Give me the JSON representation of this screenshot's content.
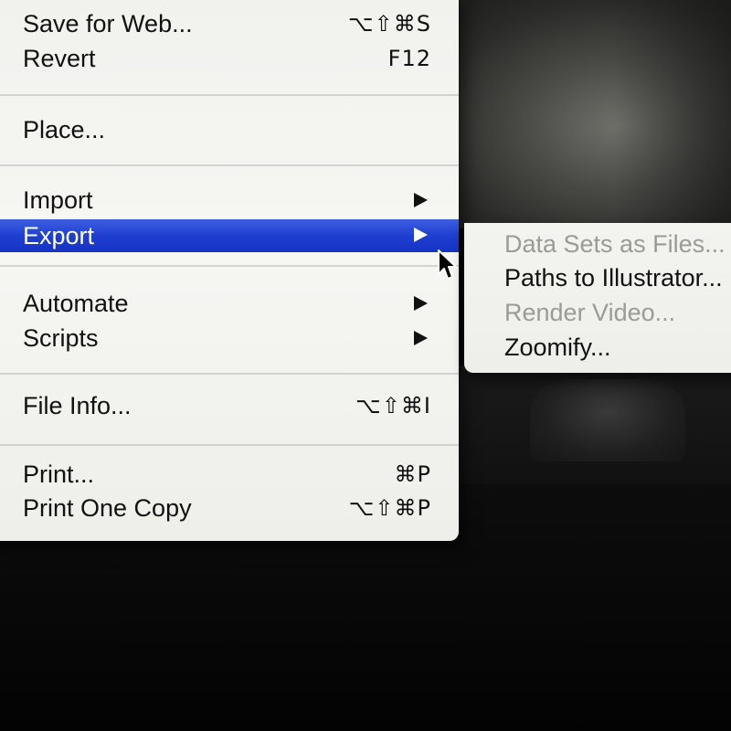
{
  "file_menu": {
    "items": [
      {
        "label": "Save for Web...",
        "shortcut": "⌥⇧⌘S"
      },
      {
        "label": "Revert",
        "shortcut": "F12"
      },
      {
        "label": "Place..."
      },
      {
        "label": "Import"
      },
      {
        "label": "Export"
      },
      {
        "label": "Automate"
      },
      {
        "label": "Scripts"
      },
      {
        "label": "File Info...",
        "shortcut": "⌥⇧⌘I"
      },
      {
        "label": "Print...",
        "shortcut": "⌘P"
      },
      {
        "label": "Print One Copy",
        "shortcut": "⌥⇧⌘P"
      }
    ],
    "highlighted_item": "Export"
  },
  "export_submenu": {
    "items": [
      {
        "label": "Data Sets as Files...",
        "enabled": false
      },
      {
        "label": "Paths to Illustrator...",
        "enabled": true
      },
      {
        "label": "Render Video...",
        "enabled": false
      },
      {
        "label": "Zoomify...",
        "enabled": true
      }
    ]
  },
  "icons": {
    "submenu_arrow": "triangle-right-icon",
    "cursor": "arrow-pointer-icon"
  },
  "colors": {
    "highlight": "#1f3fd0",
    "menu_bg": "#f3f3f0",
    "disabled_text": "#9a9a98"
  }
}
